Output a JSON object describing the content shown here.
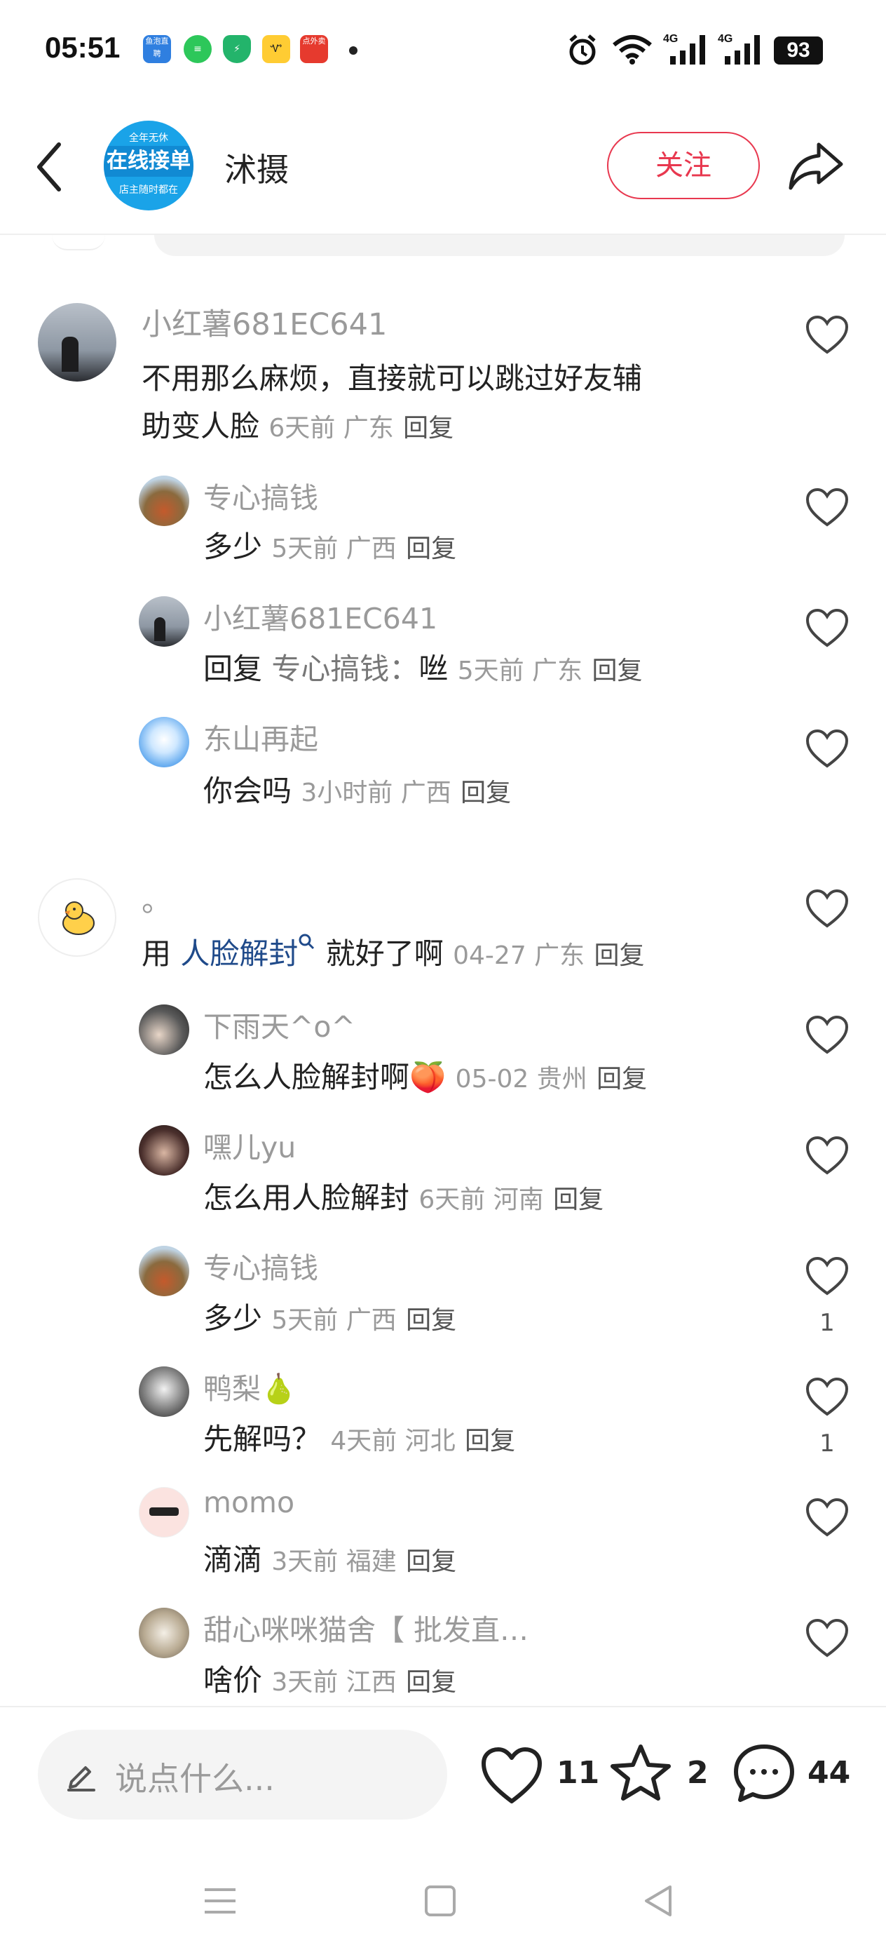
{
  "status_bar": {
    "time": "05:51",
    "app_icons": [
      {
        "name": "yupao-icon",
        "color": "#2f7fe0",
        "text": "鱼泡直聘"
      },
      {
        "name": "wechat-chat-icon",
        "color": "#2dc75a",
        "text": ""
      },
      {
        "name": "shield-icon",
        "color": "#23b46b",
        "text": ""
      },
      {
        "name": "rabbit-app-icon",
        "color": "#ffcc33",
        "text": ""
      },
      {
        "name": "waimai-app-icon",
        "color": "#e63a2e",
        "text": "点外卖"
      }
    ],
    "battery": "93"
  },
  "header": {
    "avatar_lines": [
      "全年无休",
      "在线接单",
      "店主随时都在"
    ],
    "username": "沭摄",
    "follow_label": "关注"
  },
  "comments": [
    {
      "name": "小红薯681EC641",
      "text": "不用那么麻烦，直接就可以跳过好友辅",
      "text2": "助变人脸",
      "meta": "6天前 广东",
      "reply": "回复"
    },
    {
      "name": "专心搞钱",
      "text": "多少",
      "meta": "5天前 广西",
      "reply": "回复"
    },
    {
      "name": "小红薯681EC641",
      "text": "回复",
      "text_to": "专心搞钱：",
      "text_end": "咝",
      "meta": "5天前 广东",
      "reply": "回复"
    },
    {
      "name": "东山再起",
      "text": "你会吗",
      "meta": "3小时前 广西",
      "reply": "回复"
    },
    {
      "name": "。",
      "text": "用",
      "link": "人脸解封",
      "text_end": "就好了啊",
      "meta": "04-27 广东",
      "reply": "回复"
    },
    {
      "name": "下雨天^o^",
      "text": "怎么人脸解封啊",
      "emoji": "🍑",
      "meta": "05-02 贵州",
      "reply": "回复"
    },
    {
      "name": "嘿儿yu",
      "text": "怎么用人脸解封",
      "meta": "6天前 河南",
      "reply": "回复"
    },
    {
      "name": "专心搞钱",
      "text": "多少",
      "meta": "5天前 广西",
      "reply": "回复",
      "likes": "1"
    },
    {
      "name": "鸭梨",
      "name_emoji": "🍐",
      "text": "先解吗？",
      "meta": "4天前 河北",
      "reply": "回复",
      "likes": "1"
    },
    {
      "name": "momo",
      "text": "滴滴",
      "meta": "3天前 福建",
      "reply": "回复"
    },
    {
      "name": "甜心咪咪猫舍【 批发直…",
      "text": "啥价",
      "meta": "3天前 江西",
      "reply": "回复"
    }
  ],
  "bottom_bar": {
    "placeholder": "说点什么...",
    "like_count": "11",
    "star_count": "2",
    "comment_count": "44"
  },
  "colors": {
    "accent": "#e8384f",
    "link": "#1f4a8a"
  }
}
